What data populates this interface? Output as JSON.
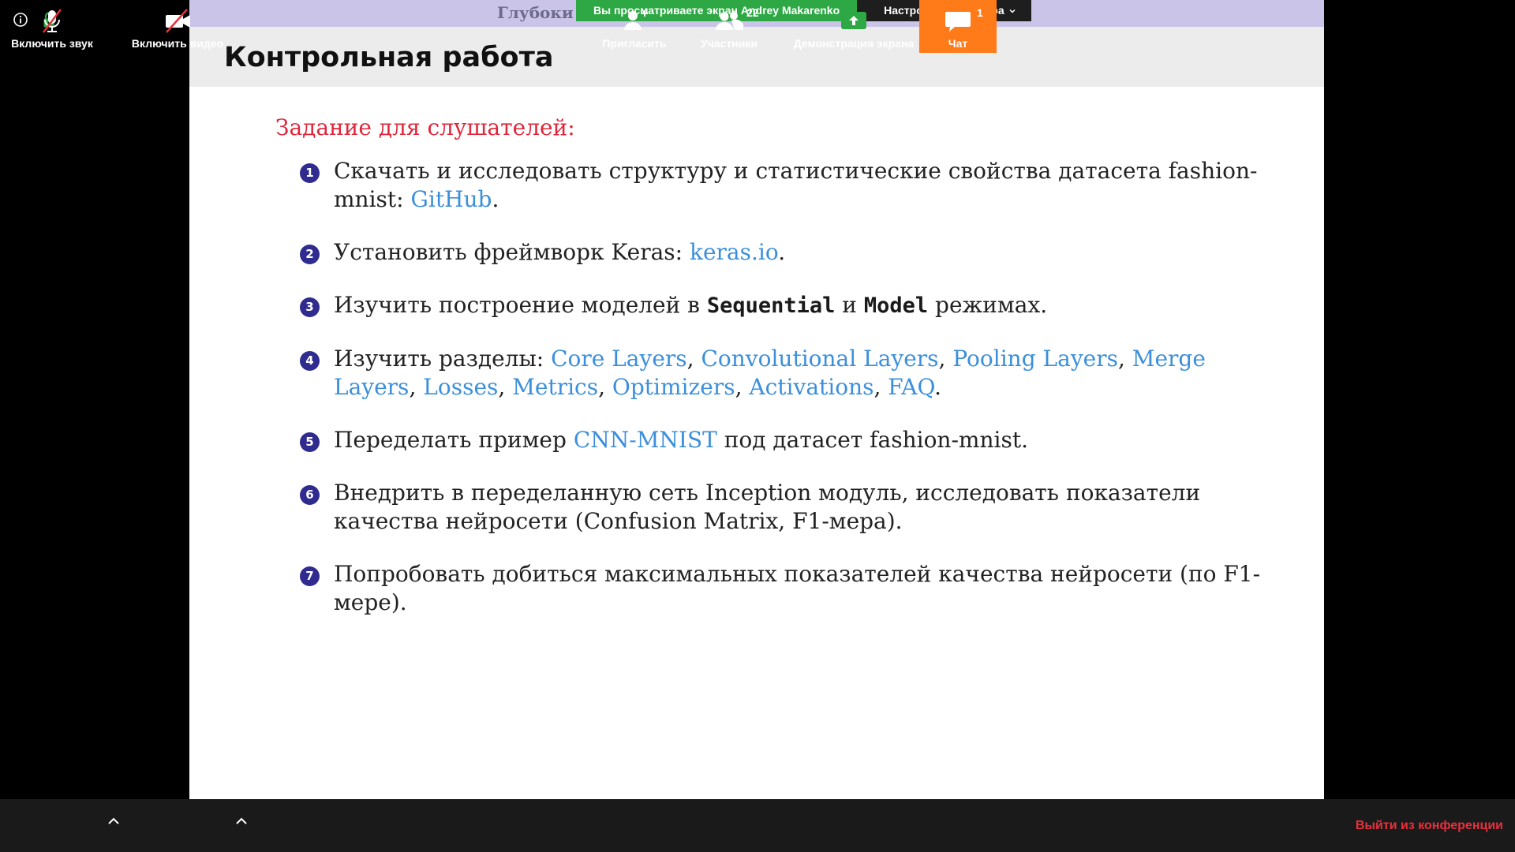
{
  "share_banner": {
    "notice": "Вы просматриваете экран Andrey Makarenko",
    "view_options": "Настройки просмотра"
  },
  "slide": {
    "topic_fragment": "Глубоки",
    "title": "Контрольная работа",
    "task_heading": "Задание для слушателей:",
    "colors": {
      "heading": "#e0263a",
      "link": "#3b8fdc",
      "number": "#2f2b8f",
      "topbar": "#c9c4e8"
    },
    "tasks": [
      {
        "num": "1",
        "t1": "Скачать и исследовать структуру и статистические свойства датасета fashion-mnist: ",
        "link1": "GitHub",
        "t2": "."
      },
      {
        "num": "2",
        "t1": "Установить фреймворк Keras: ",
        "link1": "keras.io",
        "t2": "."
      },
      {
        "num": "3",
        "t1": "Изучить построение моделей в ",
        "code1": "Sequential",
        "t2": " и ",
        "code2": "Model",
        "t3": " режимах."
      },
      {
        "num": "4",
        "t1": "Изучить разделы: ",
        "links": [
          "Core Layers",
          "Convolutional Layers",
          "Pooling Layers",
          "Merge Layers",
          "Losses",
          "Metrics",
          "Optimizers",
          "Activations",
          "FAQ"
        ],
        "sep": ", ",
        "t2": "."
      },
      {
        "num": "5",
        "t1": "Переделать пример ",
        "link1": "CNN-MNIST",
        "t2": " под датасет fashion-mnist."
      },
      {
        "num": "6",
        "t1": "Внедрить в переделанную сеть Inception модуль, исследовать показатели качества нейросети (Confusion Matrix, F1-мера)."
      },
      {
        "num": "7",
        "t1": "Попробовать добиться максимальных показателей качества нейросети (по F1-мере)."
      }
    ]
  },
  "toolbar": {
    "mute_label": "Включить звук",
    "video_label": "Включить видео",
    "invite_label": "Пригласить",
    "participants_label": "Участники",
    "participants_count": "22",
    "share_label": "Демонстрация экрана",
    "chat_label": "Чат",
    "chat_count": "1",
    "leave_label": "Выйти из конференции",
    "colors": {
      "chat_bg": "#ff7a18",
      "leave": "#e8303c",
      "share_icon": "#2ea844",
      "muted_slash": "#e8303c"
    }
  },
  "status": {
    "info_icon": "info-icon",
    "lock_icon": "lock-icon"
  }
}
